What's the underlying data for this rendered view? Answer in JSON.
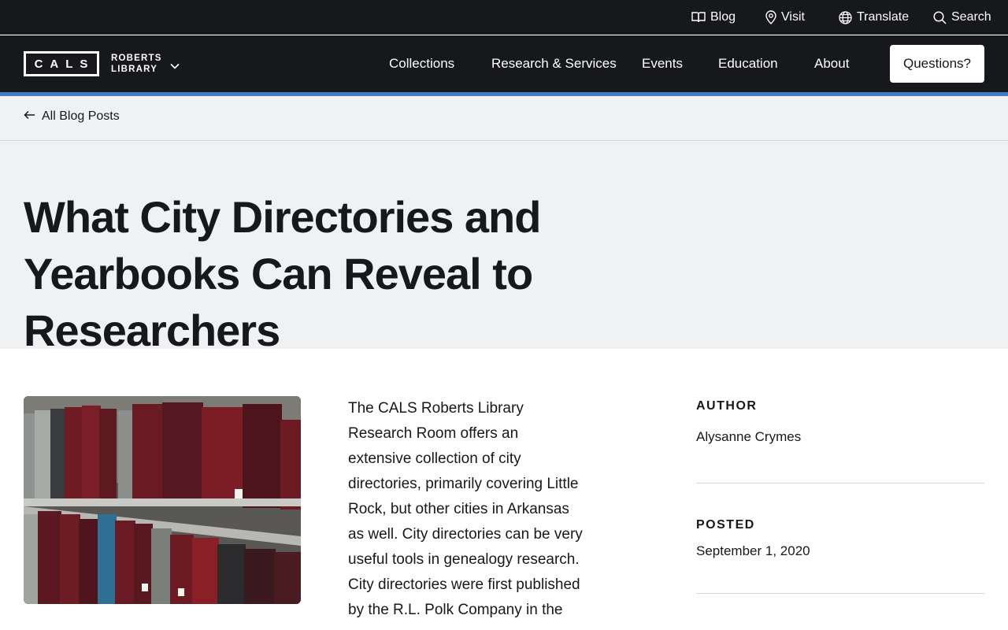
{
  "utility_nav": {
    "items": [
      {
        "label": "Blog",
        "icon": "book-icon"
      },
      {
        "label": "Visit",
        "icon": "map-pin-icon"
      },
      {
        "label": "Translate",
        "icon": "globe-icon"
      },
      {
        "label": "Search",
        "icon": "search-icon"
      }
    ]
  },
  "brand": {
    "logo_text": "CALS",
    "subtitle_line1": "ROBERTS",
    "subtitle_line2": "LIBRARY",
    "dropdown_icon": "chevron-down-icon"
  },
  "main_nav": {
    "items": [
      "Collections",
      "Research & Services",
      "Events",
      "Education",
      "About"
    ],
    "cta_label": "Questions?"
  },
  "breadcrumb": {
    "back_label": "All Blog Posts",
    "icon": "arrow-left-icon"
  },
  "article": {
    "title": "What City Directories and Yearbooks Can Reveal to Researchers",
    "body": "The CALS Roberts Library Research Room offers an extensive collection of city directories, primarily covering Little Rock, but other cities in Arkansas as well. City directories can be very useful tools in genealogy research. City directories were first published by the R.L. Polk Company in the"
  },
  "meta": {
    "author_label": "AUTHOR",
    "author_name": "Alysanne Crymes",
    "posted_label": "POSTED",
    "posted_date": "September 1, 2020"
  },
  "colors": {
    "nav_background": "#17181c",
    "accent_blue": "#3c7cc4",
    "hero_background": "#f0f1f3"
  }
}
